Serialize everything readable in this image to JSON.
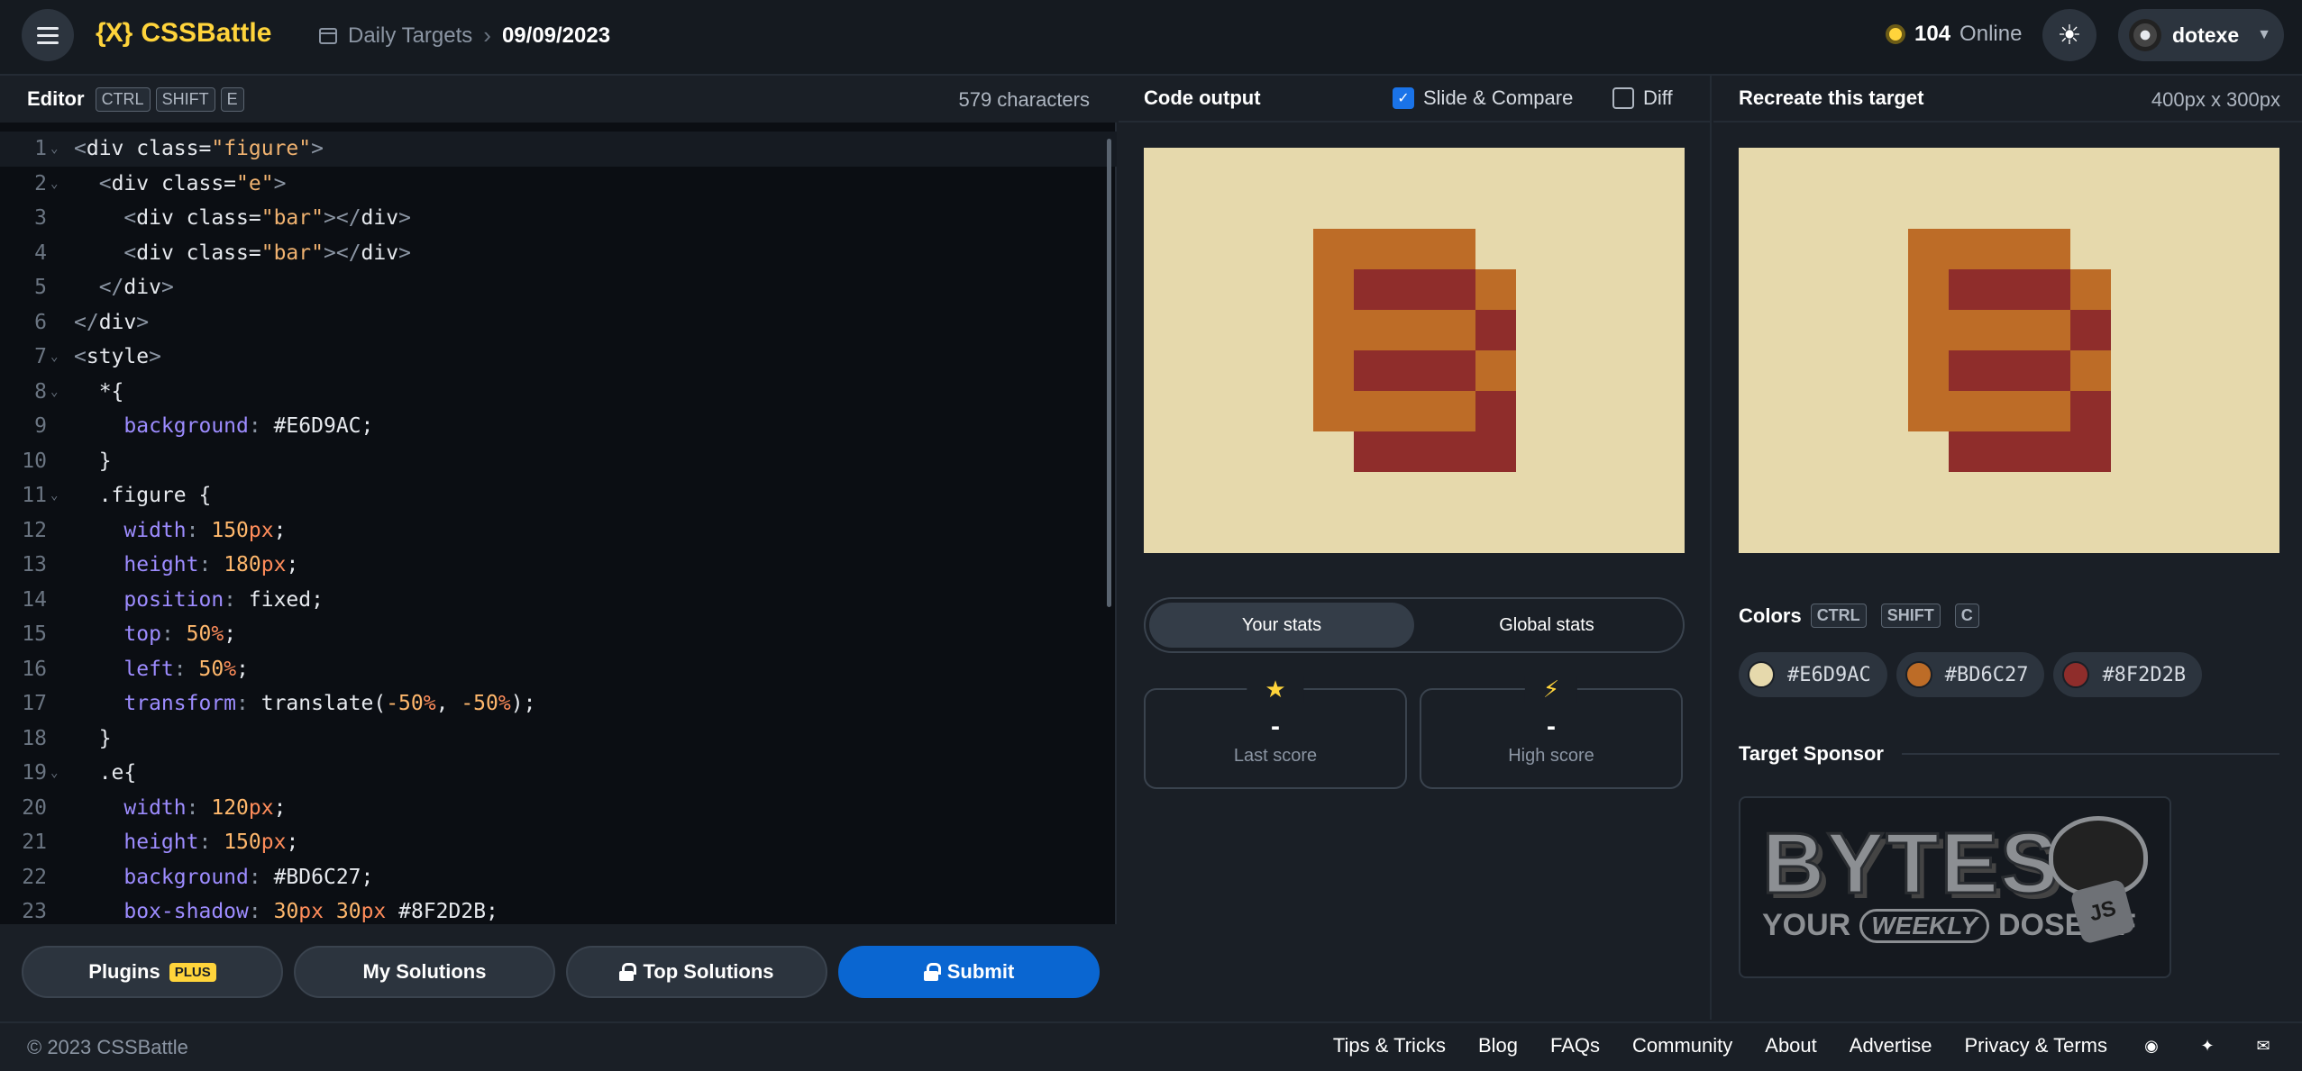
{
  "header": {
    "logo": "CSSBattle",
    "logo_mark": "{X}",
    "breadcrumb": "Daily Targets",
    "date": "09/09/2023",
    "online_count": "104",
    "online_label": "Online",
    "username": "dotexe"
  },
  "editor": {
    "title": "Editor",
    "shortcut": [
      "CTRL",
      "SHIFT",
      "E"
    ],
    "char_count": "579 characters",
    "lines": [
      {
        "n": "1",
        "fold": true,
        "text": "<div class=\"figure\">"
      },
      {
        "n": "2",
        "fold": true,
        "text": "  <div class=\"e\">"
      },
      {
        "n": "3",
        "fold": false,
        "text": "    <div class=\"bar\"></div>"
      },
      {
        "n": "4",
        "fold": false,
        "text": "    <div class=\"bar\"></div>"
      },
      {
        "n": "5",
        "fold": false,
        "text": "  </div>"
      },
      {
        "n": "6",
        "fold": false,
        "text": "</div>"
      },
      {
        "n": "7",
        "fold": true,
        "text": "<style>"
      },
      {
        "n": "8",
        "fold": true,
        "text": "  *{"
      },
      {
        "n": "9",
        "fold": false,
        "text": "    background: #E6D9AC;"
      },
      {
        "n": "10",
        "fold": false,
        "text": "  }"
      },
      {
        "n": "11",
        "fold": true,
        "text": "  .figure {"
      },
      {
        "n": "12",
        "fold": false,
        "text": "    width: 150px;"
      },
      {
        "n": "13",
        "fold": false,
        "text": "    height: 180px;"
      },
      {
        "n": "14",
        "fold": false,
        "text": "    position: fixed;"
      },
      {
        "n": "15",
        "fold": false,
        "text": "    top: 50%;"
      },
      {
        "n": "16",
        "fold": false,
        "text": "    left: 50%;"
      },
      {
        "n": "17",
        "fold": false,
        "text": "    transform: translate(-50%, -50%);"
      },
      {
        "n": "18",
        "fold": false,
        "text": "  }"
      },
      {
        "n": "19",
        "fold": true,
        "text": "  .e{"
      },
      {
        "n": "20",
        "fold": false,
        "text": "    width: 120px;"
      },
      {
        "n": "21",
        "fold": false,
        "text": "    height: 150px;"
      },
      {
        "n": "22",
        "fold": false,
        "text": "    background: #BD6C27;"
      },
      {
        "n": "23",
        "fold": false,
        "text": "    box-shadow: 30px 30px #8F2D2B;"
      }
    ],
    "buttons": {
      "plugins": "Plugins",
      "plugins_badge": "PLUS",
      "my_solutions": "My Solutions",
      "top_solutions": "Top Solutions",
      "submit": "Submit"
    }
  },
  "output": {
    "title": "Code output",
    "slide_compare": "Slide & Compare",
    "slide_compare_checked": true,
    "diff": "Diff",
    "diff_checked": false,
    "stats_tabs": [
      "Your stats",
      "Global stats"
    ],
    "last_score_value": "-",
    "last_score_label": "Last score",
    "high_score_value": "-",
    "high_score_label": "High score"
  },
  "target": {
    "title": "Recreate this target",
    "dimensions": "400px x 300px",
    "colors_title": "Colors",
    "colors_shortcut": [
      "CTRL",
      "SHIFT",
      "C"
    ],
    "colors": [
      "#E6D9AC",
      "#BD6C27",
      "#8F2D2B"
    ],
    "sponsor_title": "Target Sponsor",
    "sponsor_big": "BYTES",
    "sponsor_line": [
      "YOUR",
      "WEEKLY",
      "DOSE OF"
    ],
    "sponsor_js": "JS"
  },
  "footer": {
    "copyright": "© 2023 CSSBattle",
    "links": [
      "Tips & Tricks",
      "Blog",
      "FAQs",
      "Community",
      "About",
      "Advertise",
      "Privacy & Terms"
    ]
  }
}
